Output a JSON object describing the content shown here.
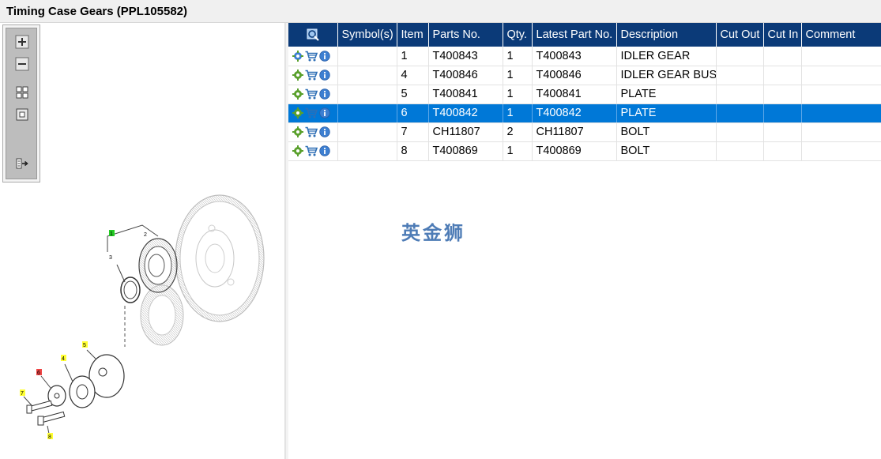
{
  "window": {
    "title": "Timing Case Gears (PPL105582)"
  },
  "toolbar": {
    "buttons": [
      {
        "name": "zoom-in-icon"
      },
      {
        "name": "zoom-out-icon"
      },
      {
        "name": "fit-window-icon"
      },
      {
        "name": "actual-size-icon"
      },
      {
        "name": "export-icon"
      }
    ]
  },
  "diagram": {
    "callouts": [
      {
        "label": "1",
        "color": "#22cc22"
      },
      {
        "label": "2",
        "color": ""
      },
      {
        "label": "3",
        "color": ""
      },
      {
        "label": "4",
        "color": "#ffff33"
      },
      {
        "label": "5",
        "color": "#ffff33"
      },
      {
        "label": "6",
        "color": "#ee4444"
      },
      {
        "label": "7",
        "color": "#ffff33"
      },
      {
        "label": "8",
        "color": "#ffff33"
      }
    ]
  },
  "table": {
    "columns": [
      "",
      "Symbol(s)",
      "Item",
      "Parts No.",
      "Qty.",
      "Latest Part No.",
      "Description",
      "Cut Out",
      "Cut In",
      "Comment"
    ],
    "rows": [
      {
        "symbols": "",
        "item": "1",
        "part_no": "T400843",
        "qty": "1",
        "latest_part_no": "T400843",
        "description": "IDLER GEAR",
        "cut_out": "",
        "cut_in": "",
        "comment": ""
      },
      {
        "symbols": "",
        "item": "4",
        "part_no": "T400846",
        "qty": "1",
        "latest_part_no": "T400846",
        "description": "IDLER GEAR BUSH",
        "cut_out": "",
        "cut_in": "",
        "comment": ""
      },
      {
        "symbols": "",
        "item": "5",
        "part_no": "T400841",
        "qty": "1",
        "latest_part_no": "T400841",
        "description": "PLATE",
        "cut_out": "",
        "cut_in": "",
        "comment": ""
      },
      {
        "symbols": "",
        "item": "6",
        "part_no": "T400842",
        "qty": "1",
        "latest_part_no": "T400842",
        "description": "PLATE",
        "cut_out": "",
        "cut_in": "",
        "comment": ""
      },
      {
        "symbols": "",
        "item": "7",
        "part_no": "CH11807",
        "qty": "2",
        "latest_part_no": "CH11807",
        "description": "BOLT",
        "cut_out": "",
        "cut_in": "",
        "comment": ""
      },
      {
        "symbols": "",
        "item": "8",
        "part_no": "T400869",
        "qty": "1",
        "latest_part_no": "T400869",
        "description": "BOLT",
        "cut_out": "",
        "cut_in": "",
        "comment": ""
      }
    ],
    "selected_row": 3
  },
  "watermark": "英金狮",
  "colors": {
    "header_bg": "#0b3a78",
    "selection_bg": "#0078d7",
    "gear_icon": "#5aa02c",
    "cart_icon": "#2e6fb5",
    "info_icon": "#3d7fd1"
  }
}
